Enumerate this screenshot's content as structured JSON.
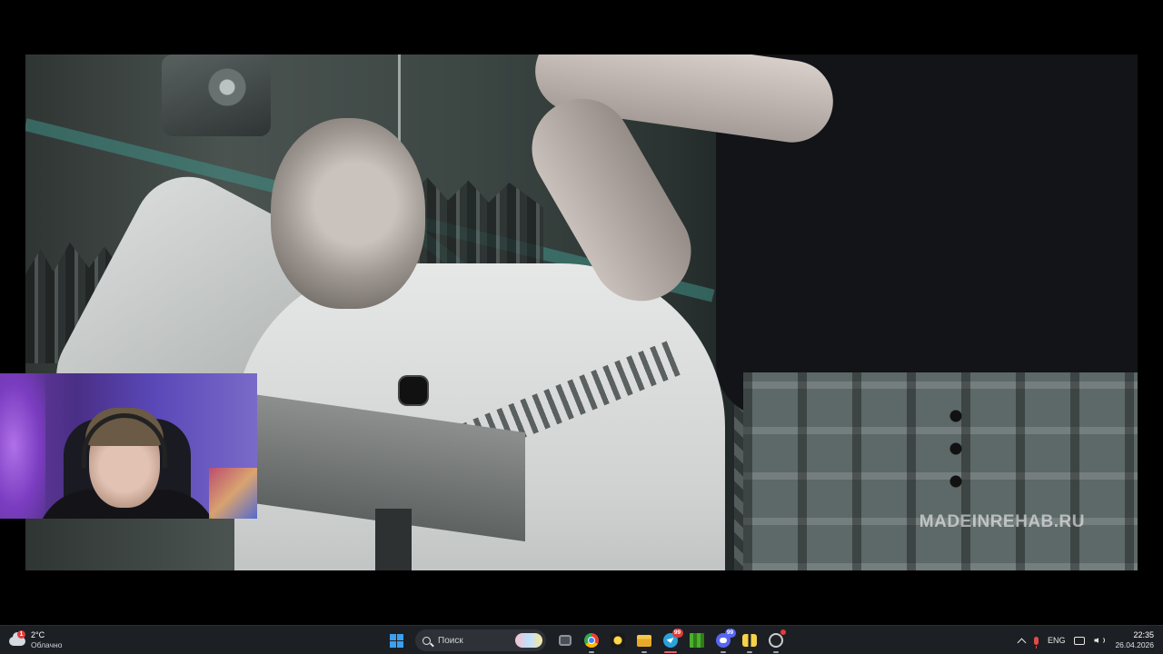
{
  "video": {
    "watermark": "MADEINREHAB.RU"
  },
  "webcam": {},
  "taskbar": {
    "weather": {
      "temperature": "2°C",
      "condition": "Облачно",
      "alert_badge": "1",
      "icon": "cloud-icon"
    },
    "search": {
      "label": "Поиск",
      "icon": "search-icon"
    },
    "apps": [
      {
        "name": "start",
        "icon": "windows-logo-icon"
      },
      {
        "name": "task-view",
        "icon": "task-view-icon"
      },
      {
        "name": "chrome",
        "icon": "chrome-icon"
      },
      {
        "name": "spark-app",
        "icon": "spark-icon"
      },
      {
        "name": "file-explorer",
        "icon": "folder-icon"
      },
      {
        "name": "telegram",
        "icon": "telegram-icon",
        "badge": "99"
      },
      {
        "name": "minecraft",
        "icon": "minecraft-icon"
      },
      {
        "name": "discord",
        "icon": "discord-icon",
        "badge": "99"
      },
      {
        "name": "twin-app",
        "icon": "twin-bars-icon"
      },
      {
        "name": "obs",
        "icon": "obs-icon"
      }
    ],
    "tray": {
      "language": "ENG",
      "time": "22:35",
      "date": "26.04.2026"
    }
  },
  "colors": {
    "taskbar_bg": "#1c1f24",
    "accent_red": "#e9595f",
    "windows_blue": "#3aa0f0"
  }
}
